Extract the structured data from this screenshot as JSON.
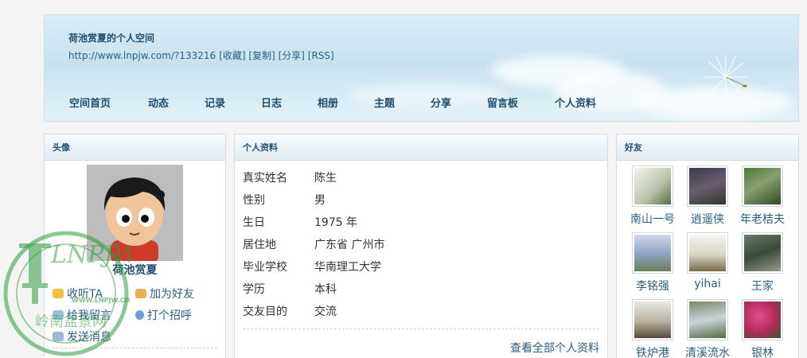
{
  "header": {
    "title": "荷池赏夏的个人空间",
    "url": "http://www.lnpjw.com/?133216",
    "links": [
      "[收藏]",
      "[复制]",
      "[分享]",
      "[RSS]"
    ]
  },
  "nav": [
    "空间首页",
    "动态",
    "记录",
    "日志",
    "相册",
    "主题",
    "分享",
    "留言板",
    "个人资料"
  ],
  "avatar_panel": {
    "title": "头像",
    "name": "荷池赏夏",
    "actions": [
      "收听TA",
      "加为好友",
      "给我留言",
      "打个招呼",
      "发送消息"
    ]
  },
  "profile_panel": {
    "title": "个人资料",
    "fields": [
      {
        "label": "真实姓名",
        "value": "陈生"
      },
      {
        "label": "性别",
        "value": "男"
      },
      {
        "label": "生日",
        "value": "1975 年"
      },
      {
        "label": "居住地",
        "value": "广东省 广州市"
      },
      {
        "label": "毕业学校",
        "value": "华南理工大学"
      },
      {
        "label": "学历",
        "value": "本科"
      },
      {
        "label": "交友目的",
        "value": "交流"
      }
    ],
    "more_link": "查看全部个人资料"
  },
  "friends_panel": {
    "title": "好友",
    "friends": [
      "南山一号",
      "逍遥侠",
      "年老桔夫",
      "李铭强",
      "yihai",
      "王家",
      "铁炉港",
      "清溪流水",
      "银林"
    ]
  },
  "watermark": {
    "text_top": "LNPJW",
    "url": "WWW.LNPJW.COM",
    "text_cn": "岭南盆景网"
  },
  "colors": {
    "link": "#2b5f82",
    "heading": "#1f4e6e",
    "watermark": "#2e9a3c"
  }
}
